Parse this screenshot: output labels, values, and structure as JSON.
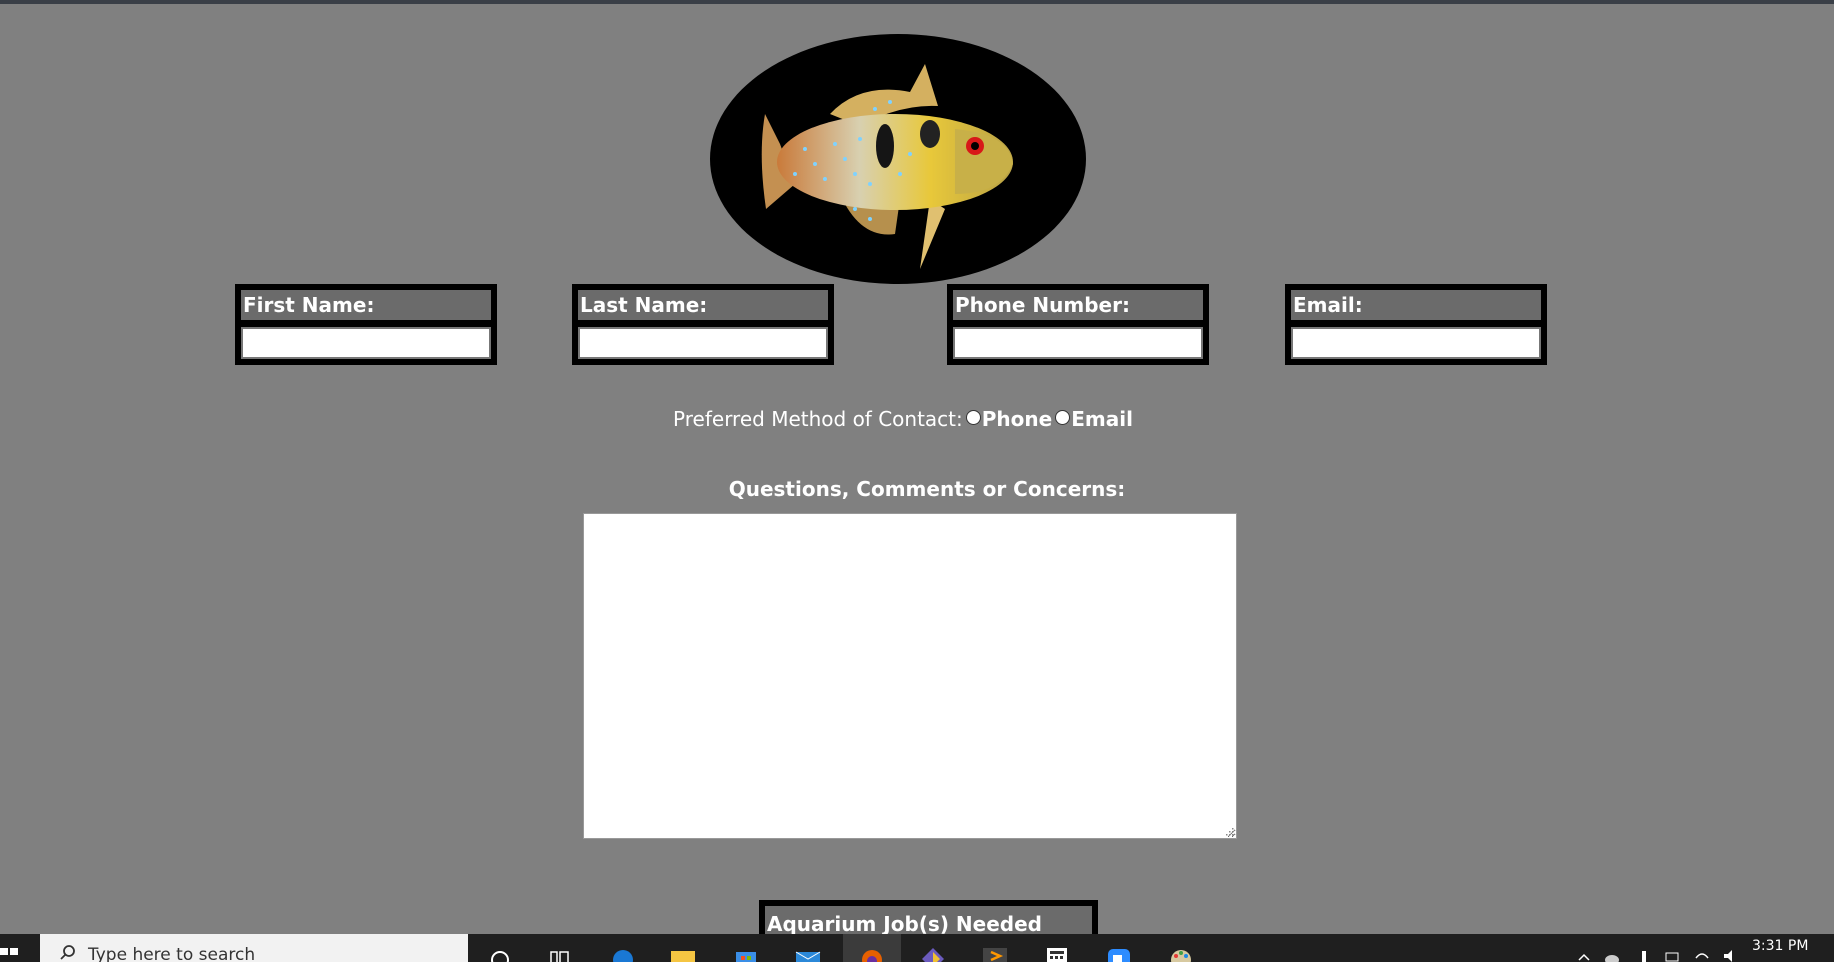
{
  "fields": {
    "first_name": {
      "label": "First Name:",
      "value": ""
    },
    "last_name": {
      "label": "Last Name:",
      "value": ""
    },
    "phone": {
      "label": "Phone Number:",
      "value": ""
    },
    "email": {
      "label": "Email:",
      "value": ""
    }
  },
  "contact": {
    "label": "Preferred Method of Contact:",
    "options": [
      "Phone",
      "Email"
    ]
  },
  "comments": {
    "heading": "Questions, Comments or Concerns:",
    "value": ""
  },
  "jobs": {
    "label": "Aquarium Job(s) Needed"
  },
  "taskbar": {
    "search_placeholder": "Type here to search",
    "clock": "3:31 PM",
    "icons": [
      "windows-icon",
      "cortana-icon",
      "task-view-icon",
      "edge-icon",
      "file-explorer-icon",
      "store-icon",
      "mail-icon",
      "firefox-icon",
      "app-icon",
      "sublime-icon",
      "calculator-icon",
      "zoom-icon",
      "paint-icon"
    ]
  },
  "colors": {
    "page_bg": "#808080",
    "label_bg": "#6b6b6b",
    "box_border": "#000000",
    "taskbar": "#1f1f1f"
  }
}
